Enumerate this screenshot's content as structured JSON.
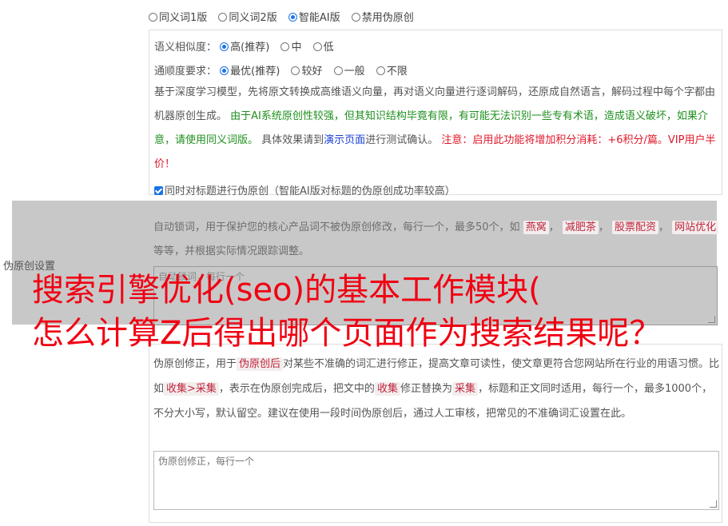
{
  "mode": {
    "options": [
      "同义词1版",
      "同义词2版",
      "智能AI版",
      "禁用伪原创"
    ],
    "selected_index": 2
  },
  "similarity": {
    "label": "语义相似度：",
    "options": [
      "高(推荐)",
      "中",
      "低"
    ],
    "selected_index": 0
  },
  "fluency": {
    "label": "通顺度要求：",
    "options": [
      "最优(推荐)",
      "较好",
      "一般",
      "不限"
    ],
    "selected_index": 0
  },
  "description": {
    "part1": "基于深度学习模型，先将原文转换成高维语义向量，再对语义向量进行逐词解码，还原成自然语言，解码过程中每个字都由机器原创生成。",
    "part2_green": "由于AI系统原创性较强，但其知识结构毕竟有限，有可能无法识别一些专有术语，造成语义破坏，如果介意，请使用同义词版。",
    "part3_a": "具体效果请到",
    "part3_link": "演示页面",
    "part3_b": "进行测试确认。",
    "part4_red": "注意：启用此功能将增加积分消耗：+6积分/篇。VIP用户半价！"
  },
  "title_option": {
    "label": "同时对标题进行伪原创（智能AI版对标题的伪原创成功率较高）",
    "checked": true
  },
  "side_label": "伪原创设置",
  "lock": {
    "text_a": "自动锁词，用于保护您的核心产品词不被伪原创修改，每行一个，最多50个，如",
    "tags": [
      "燕窝",
      "减肥茶",
      "股票配资",
      "网站优化"
    ],
    "text_b": "等等，并根据实际情况跟踪调整。",
    "placeholder": "自动锁词，每行一个"
  },
  "banner": {
    "line1": "搜索引擎优化(seo)的基本工作模块(",
    "line2": "怎么计算Z后得出哪个页面作为搜索结果呢？"
  },
  "fix": {
    "text_a": "伪原创修正，用于",
    "tag1": "伪原创后",
    "text_b": "对某些不准确的词汇进行修正，提高文章可读性，使文章更符合您网站所在行业的用语习惯。比如",
    "tag2": "收集>采集",
    "text_c": "，表示在伪原创完成后，把文中的",
    "tag3": "收集",
    "text_d": "修正替换为",
    "tag4": "采集",
    "text_e": "，标题和正文同时适用，每行一个，最多1000个，不分大小写，默认留空。建议在使用一段时间伪原创后，通过人工审核，把常见的不准确词汇设置在此。",
    "placeholder": "伪原创修正，每行一个"
  }
}
